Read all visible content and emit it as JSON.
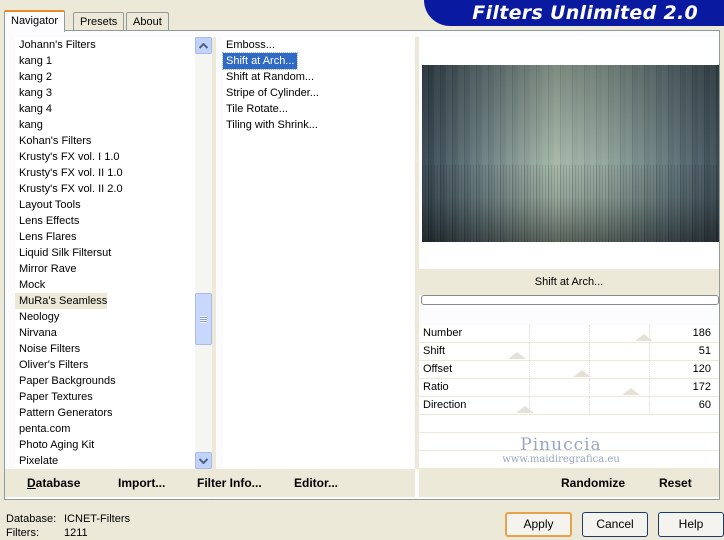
{
  "tabs": [
    "Navigator",
    "Presets",
    "About"
  ],
  "banner_title": "Filters Unlimited 2.0",
  "categories": [
    "Johann's Filters",
    "kang 1",
    "kang 2",
    "kang 3",
    "kang 4",
    "kang",
    "Kohan's Filters",
    "Krusty's FX vol. I 1.0",
    "Krusty's FX vol. II 1.0",
    "Krusty's FX vol. II 2.0",
    "Layout Tools",
    "Lens Effects",
    "Lens Flares",
    "Liquid Silk Filtersut",
    "Mirror Rave",
    "Mock",
    "MuRa's Seamless",
    "Neology",
    "Nirvana",
    "Noise Filters",
    "Oliver's Filters",
    "Paper Backgrounds",
    "Paper Textures",
    "Pattern Generators",
    "penta.com",
    "Photo Aging Kit",
    "Pixelate"
  ],
  "selected_category": "MuRa's Seamless",
  "filters": [
    "Emboss...",
    "Shift at Arch...",
    "Shift at Random...",
    "Stripe of Cylinder...",
    "Tile Rotate...",
    "Tiling with Shrink..."
  ],
  "selected_filter": "Shift at Arch...",
  "preview_filter_name": "Shift at Arch...",
  "progress": 0,
  "params": [
    {
      "label": "Number",
      "value": "186",
      "level": 186
    },
    {
      "label": "Shift",
      "value": "51",
      "level": 51
    },
    {
      "label": "Offset",
      "value": "120",
      "level": 120
    },
    {
      "label": "Ratio",
      "value": "172",
      "level": 172
    },
    {
      "label": "Direction",
      "value": "60",
      "level": 60
    }
  ],
  "param_max": 255,
  "buttons_left": {
    "database": "Database",
    "import": "Import...",
    "filter_info": "Filter Info...",
    "editor": "Editor..."
  },
  "buttons_right": {
    "randomize": "Randomize",
    "reset": "Reset"
  },
  "status": {
    "database_label": "Database:",
    "database_value": "ICNET-Filters",
    "filters_label": "Filters:",
    "filters_value": "1211"
  },
  "dialog_buttons": {
    "apply": "Apply",
    "cancel": "Cancel",
    "help": "Help"
  },
  "watermark": {
    "line1": "Pinuccia",
    "line2": "www.maidiregrafica.eu"
  },
  "colors": {
    "accent": "#316ac5",
    "banner": "#0a1aa0",
    "default_button": "#e7a34a"
  }
}
